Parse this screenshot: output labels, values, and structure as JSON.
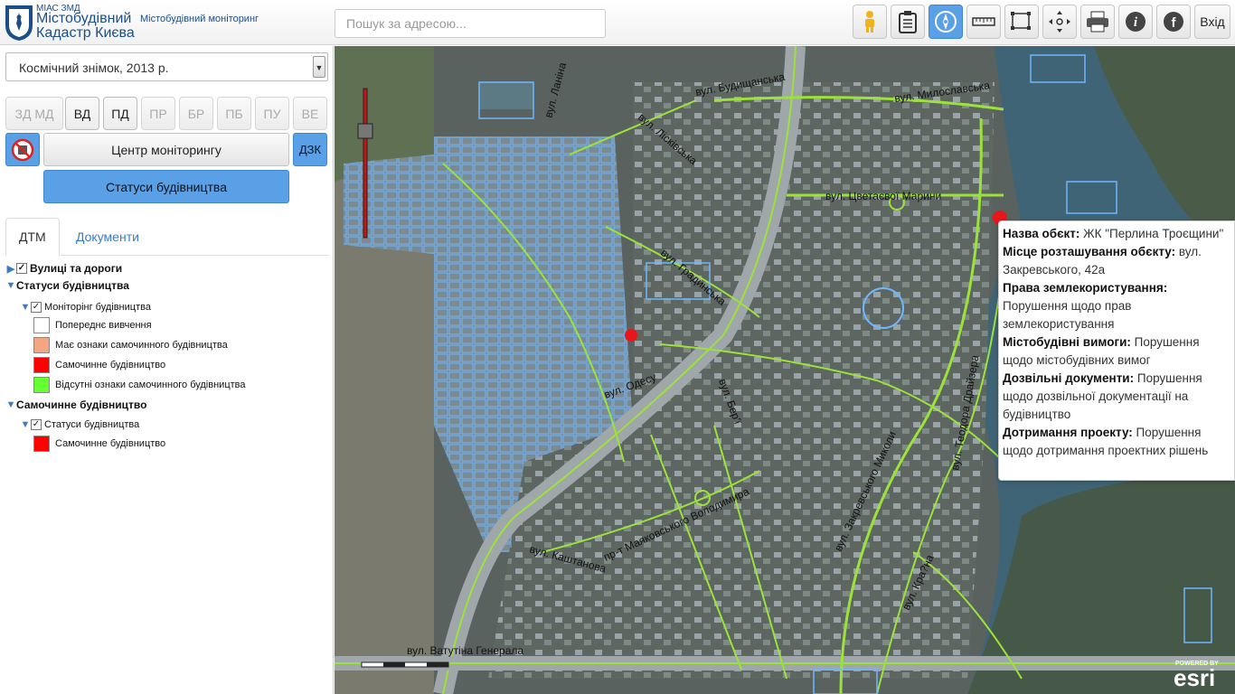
{
  "header": {
    "logo_small": "МІАС ЗМД",
    "logo_title_line1": "Містобудівний",
    "logo_title_line2": "Кадастр Києва",
    "subtitle": "Містобудівний моніторинг",
    "search_placeholder": "Пошук за адресою...",
    "login_label": "Вхід",
    "toolbar_icons": [
      "pegman-icon",
      "clipboard-icon",
      "compass-icon",
      "measure-line-icon",
      "measure-area-icon",
      "crosshair-icon",
      "print-icon",
      "info-icon",
      "facebook-icon"
    ],
    "active_tool": "compass-icon"
  },
  "sidebar": {
    "basemap_select": "Космічний знімок, 2013 р.",
    "dtm_buttons": [
      {
        "label": "ЗД МД",
        "enabled": false
      },
      {
        "label": "ВД",
        "enabled": true
      },
      {
        "label": "ПД",
        "enabled": true
      },
      {
        "label": "ПР",
        "enabled": false
      },
      {
        "label": "БР",
        "enabled": false
      },
      {
        "label": "ПБ",
        "enabled": false
      },
      {
        "label": "ПУ",
        "enabled": false
      },
      {
        "label": "ВЕ",
        "enabled": false
      }
    ],
    "center_button": "Центр моніторингу",
    "dzk_button": "ДЗК",
    "status_button": "Статуси будівництва",
    "tabs": [
      "ДТМ",
      "Документи"
    ],
    "tree": {
      "roads": "Вулиці та дороги",
      "statuses_group": "Статуси будівництва",
      "monitoring": "Моніторінг будівництва",
      "legend": [
        {
          "label": "Попереднє вивчення",
          "color": "#ffffff"
        },
        {
          "label": "Має ознаки самочинного будівництва",
          "color": "#f4a582"
        },
        {
          "label": "Самочинне будівництво",
          "color": "#ff0000"
        },
        {
          "label": "Відсутні ознаки самочинного будівництва",
          "color": "#66ff33"
        }
      ],
      "illegal_group": "Самочинне будівництво",
      "illegal_sub": "Статуси будівництва",
      "illegal_legend": [
        {
          "label": "Самочинне будівництво",
          "color": "#ff0000"
        }
      ]
    }
  },
  "map": {
    "street_labels": [
      "вул. Ланіна",
      "вул. Будищанська",
      "вул. Милославська",
      "вул. Лісківська",
      "вул. Цветаєвої Марини",
      "вул. Градинська",
      "вул. Одесу",
      "вул. Бер'ї",
      "пр-т Маяковського Володимира",
      "вул. Каштанова",
      "вул. Ватутіна Генерала",
      "вул. Закревського Миколи",
      "вул. Кра?на",
      "вул. Теодора Драйзера"
    ],
    "attribution": "esri",
    "attribution_small": "POWERED BY"
  },
  "popup": {
    "fields": [
      {
        "key": "Назва обєкт:",
        "value": " ЖК \"Перлина Троєщини\""
      },
      {
        "key": "Місце розташування обєкту:",
        "value": " вул. Закревського, 42а"
      },
      {
        "key": "Права землекористування:",
        "value": " Порушення щодо прав землекористування"
      },
      {
        "key": "Містобудівні вимоги:",
        "value": " Порушення щодо містобудівних вимог"
      },
      {
        "key": "Дозвільні документи:",
        "value": " Порушення щодо дозвільної документації на будівництво"
      },
      {
        "key": "Дотримання проекту:",
        "value": " Порушення щодо дотримання проектних рішень"
      }
    ]
  },
  "colors": {
    "accent": "#5aa0e6",
    "brand": "#1b4f8a",
    "parcel": "#6fb7ff",
    "road": "#9be33a",
    "marker": "#e8161b"
  }
}
